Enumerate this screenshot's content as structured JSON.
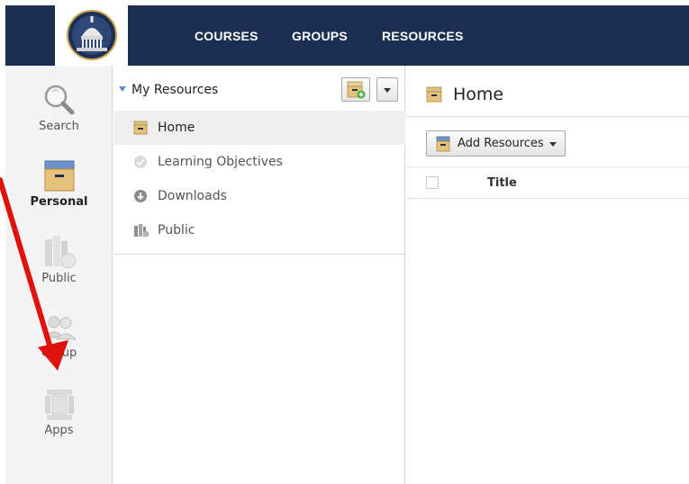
{
  "topnav": {
    "items": [
      "COURSES",
      "GROUPS",
      "RESOURCES"
    ]
  },
  "rail": {
    "items": [
      {
        "label": "Search",
        "icon": "search-icon"
      },
      {
        "label": "Personal",
        "icon": "personal-box-icon",
        "active": true
      },
      {
        "label": "Public",
        "icon": "public-books-icon"
      },
      {
        "label": "Group",
        "icon": "group-people-icon"
      },
      {
        "label": "Apps",
        "icon": "apps-icon"
      }
    ]
  },
  "tree": {
    "title": "My Resources",
    "items": [
      {
        "label": "Home",
        "icon": "home-box-icon",
        "selected": true
      },
      {
        "label": "Learning Objectives",
        "icon": "learning-objectives-icon"
      },
      {
        "label": "Downloads",
        "icon": "download-icon"
      },
      {
        "label": "Public",
        "icon": "public-icon"
      }
    ]
  },
  "content": {
    "title": "Home",
    "add_label": "Add Resources",
    "column_title": "Title"
  },
  "colors": {
    "topbar": "#1b2f52",
    "rail_bg": "#f4f4f4",
    "annotation_arrow": "#e0120f",
    "box_accent": "#e8c27a"
  }
}
